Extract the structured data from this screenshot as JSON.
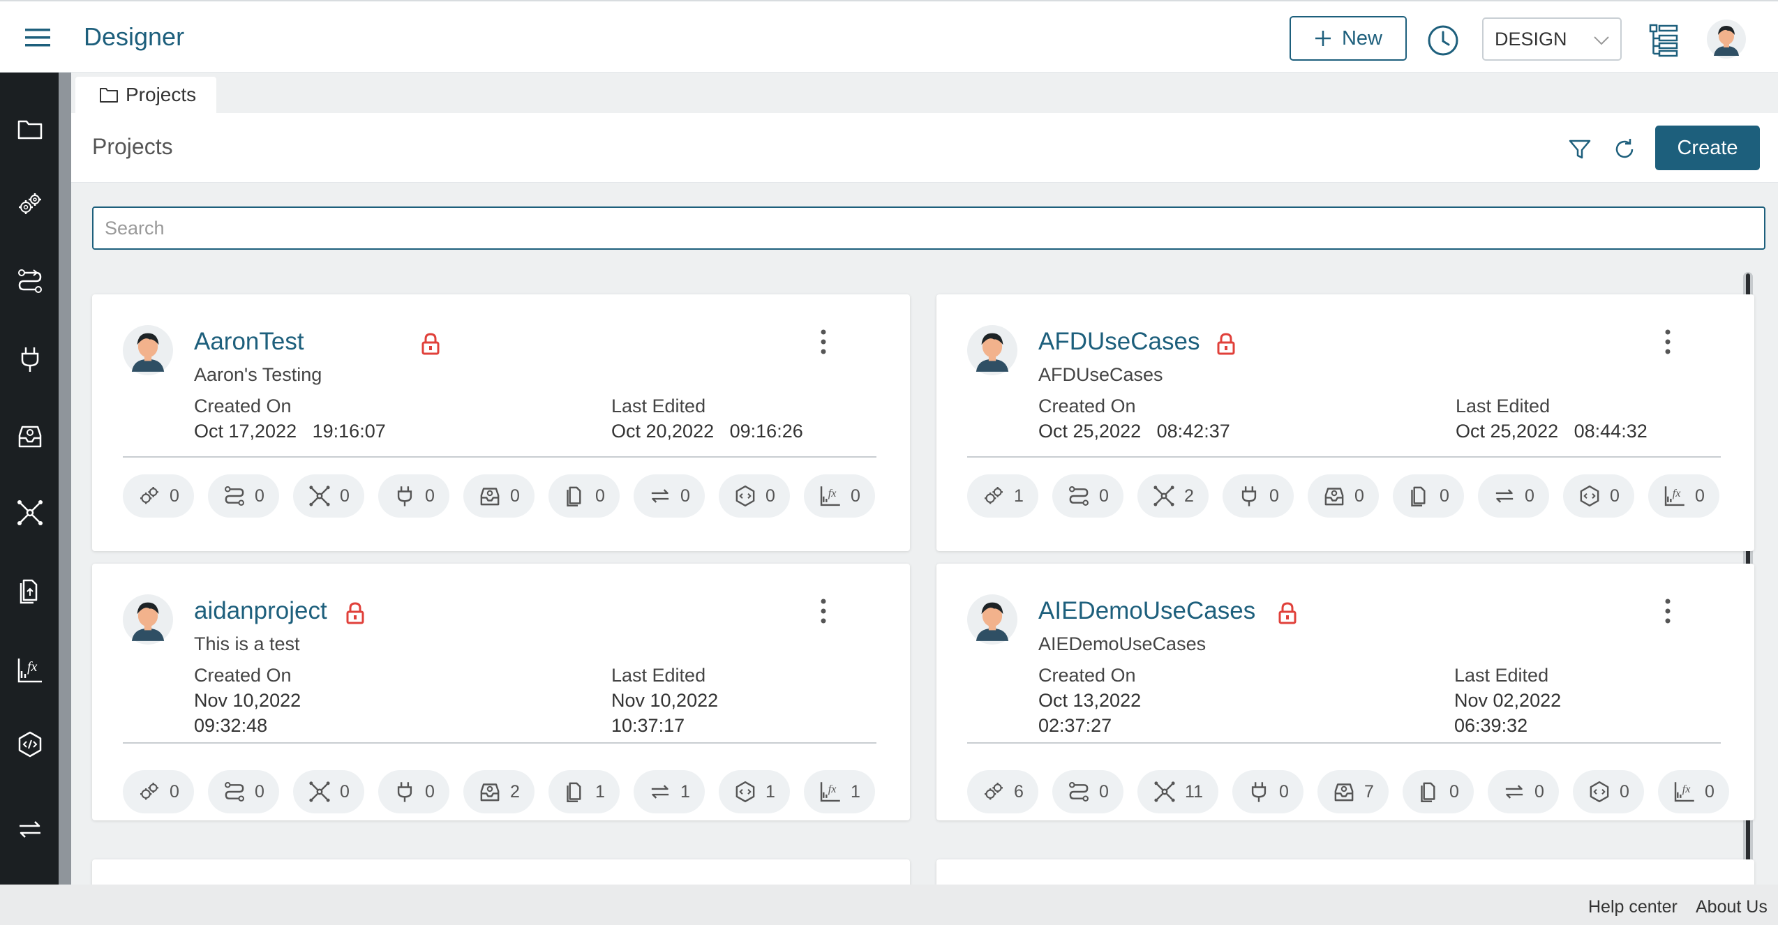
{
  "header": {
    "title": "Designer",
    "new_label": "New",
    "mode": "DESIGN"
  },
  "tab": {
    "label": "Projects"
  },
  "toolbar": {
    "title": "Projects",
    "create_label": "Create"
  },
  "search": {
    "placeholder": "Search",
    "value": ""
  },
  "labels": {
    "created": "Created On",
    "edited": "Last Edited"
  },
  "chip_icons": [
    "gears-icon",
    "flow-icon",
    "network-icon",
    "plug-icon",
    "inbox-icon",
    "documents-icon",
    "repeat-icon",
    "hex-code-icon",
    "function-chart-icon"
  ],
  "projects": [
    {
      "name": "AaronTest",
      "description": "Aaron's Testing",
      "created_date": "Oct 17,2022",
      "created_time": "19:16:07",
      "edited_date": "Oct 20,2022",
      "edited_time": "09:16:26",
      "counts": [
        "0",
        "0",
        "0",
        "0",
        "0",
        "0",
        "0",
        "0",
        "0"
      ]
    },
    {
      "name": "AFDUseCases",
      "description": "AFDUseCases",
      "created_date": "Oct 25,2022",
      "created_time": "08:42:37",
      "edited_date": "Oct 25,2022",
      "edited_time": "08:44:32",
      "counts": [
        "1",
        "0",
        "2",
        "0",
        "0",
        "0",
        "0",
        "0",
        "0"
      ]
    },
    {
      "name": "aidanproject",
      "description": "This is a test",
      "created_date": "Nov 10,2022",
      "created_time": "09:32:48",
      "edited_date": "Nov 10,2022",
      "edited_time": "10:37:17",
      "counts": [
        "0",
        "0",
        "0",
        "0",
        "2",
        "1",
        "1",
        "1",
        "1"
      ]
    },
    {
      "name": "AIEDemoUseCases",
      "description": "AIEDemoUseCases",
      "created_date": "Oct 13,2022",
      "created_time": "02:37:27",
      "edited_date": "Nov 02,2022",
      "edited_time": "06:39:32",
      "counts": [
        "6",
        "0",
        "11",
        "0",
        "7",
        "0",
        "0",
        "0",
        "0"
      ]
    }
  ],
  "footer": {
    "help": "Help center",
    "about": "About Us"
  },
  "colors": {
    "accent": "#1d5f7c",
    "sidebar": "#1b1f22",
    "lock": "#e0403a"
  }
}
